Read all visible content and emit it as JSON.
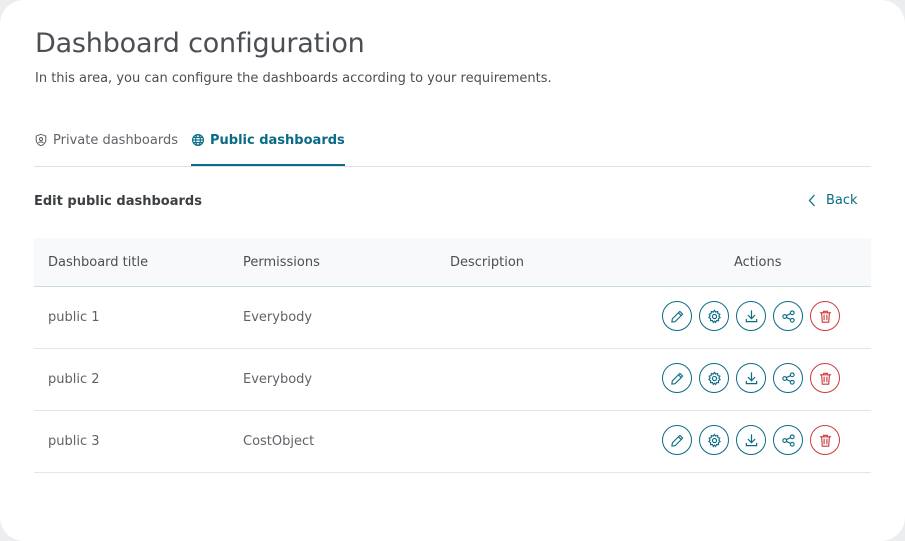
{
  "page": {
    "title": "Dashboard configuration",
    "subtitle": "In this area, you can configure the dashboards according to your requirements."
  },
  "tabs": [
    {
      "label": "Private dashboards",
      "icon": "shield-user-icon",
      "active": false
    },
    {
      "label": "Public dashboards",
      "icon": "globe-icon",
      "active": true
    }
  ],
  "section": {
    "title": "Edit public dashboards",
    "back_label": "Back"
  },
  "table": {
    "columns": [
      "Dashboard title",
      "Permissions",
      "Description",
      "Actions"
    ],
    "rows": [
      {
        "title": "public 1",
        "permissions": "Everybody",
        "description": ""
      },
      {
        "title": "public 2",
        "permissions": "Everybody",
        "description": ""
      },
      {
        "title": "public 3",
        "permissions": "CostObject",
        "description": ""
      }
    ],
    "actions": [
      "edit-icon",
      "settings-icon",
      "download-icon",
      "share-icon",
      "delete-icon"
    ]
  },
  "colors": {
    "accent": "#0a6b86",
    "danger": "#cc3b3b"
  }
}
